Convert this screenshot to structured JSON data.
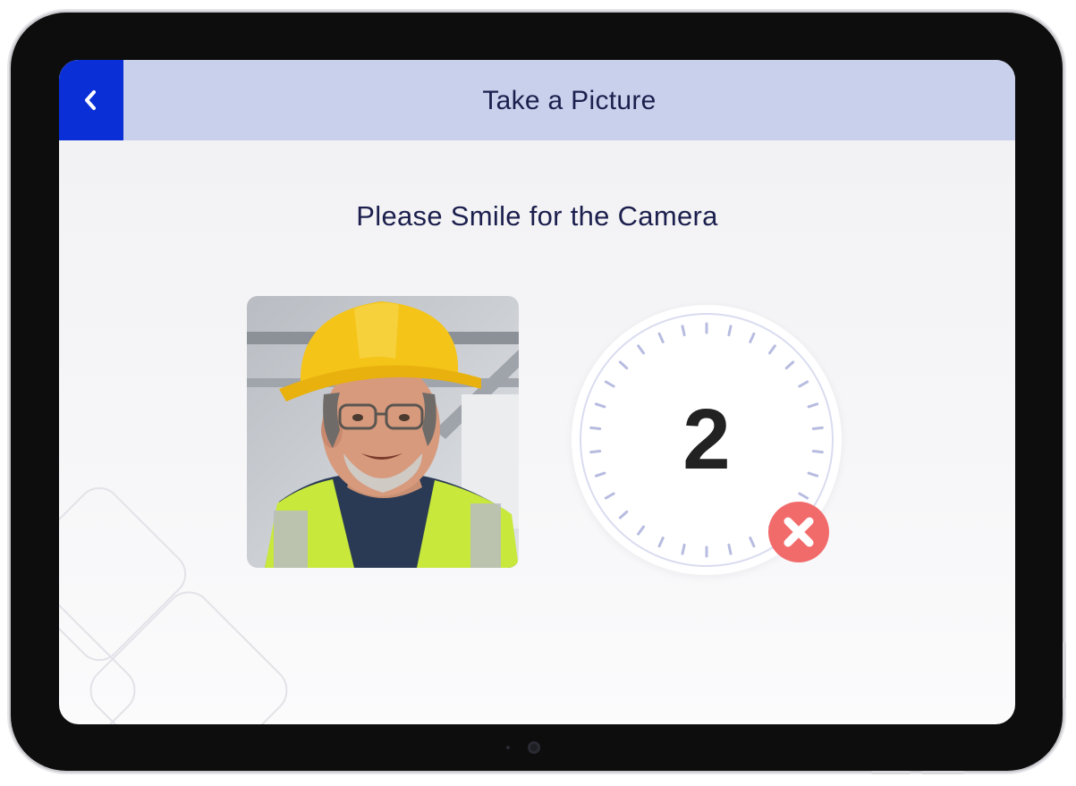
{
  "header": {
    "title": "Take a Picture",
    "back_icon": "chevron-left-icon"
  },
  "prompt": "Please Smile for the Camera",
  "photo": {
    "subject": "worker-in-hard-hat-and-safety-vest"
  },
  "countdown": {
    "value": "2"
  },
  "cancel": {
    "icon": "close-x-icon"
  },
  "colors": {
    "header_bg": "#c9d0ec",
    "back_button_bg": "#0a2fd6",
    "title_text": "#1c1f4d",
    "cancel_bg": "#f26b6b",
    "countdown_text": "#222222"
  }
}
